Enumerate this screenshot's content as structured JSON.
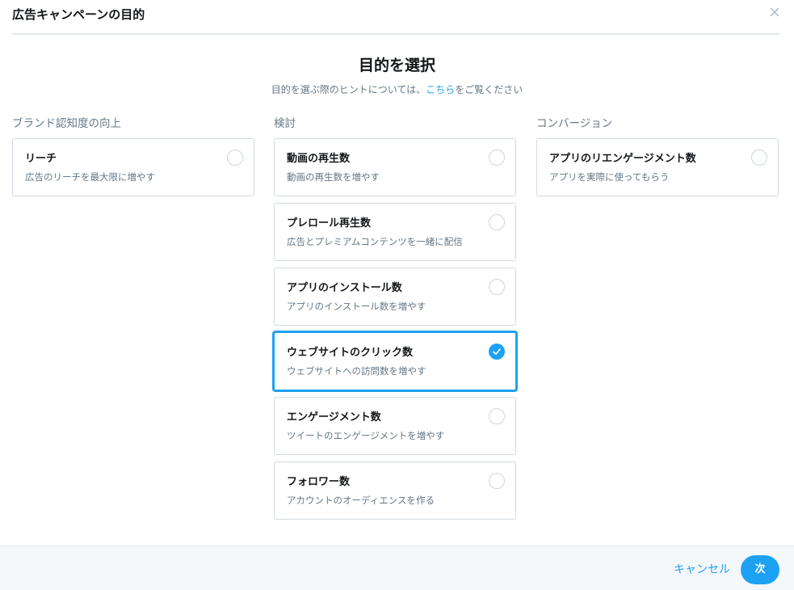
{
  "header": {
    "title": "広告キャンペーンの目的"
  },
  "main": {
    "title": "目的を選択",
    "subtitle_prefix": "目的を選ぶ際のヒントについては、",
    "subtitle_link": "こちら",
    "subtitle_suffix": "をご覧ください"
  },
  "columns": [
    {
      "heading": "ブランド認知度の向上",
      "options": [
        {
          "title": "リーチ",
          "desc": "広告のリーチを最大限に増やす",
          "selected": false
        }
      ]
    },
    {
      "heading": "検討",
      "options": [
        {
          "title": "動画の再生数",
          "desc": "動画の再生数を増やす",
          "selected": false
        },
        {
          "title": "プレロール再生数",
          "desc": "広告とプレミアムコンテンツを一緒に配信",
          "selected": false
        },
        {
          "title": "アプリのインストール数",
          "desc": "アプリのインストール数を増やす",
          "selected": false
        },
        {
          "title": "ウェブサイトのクリック数",
          "desc": "ウェブサイトへの訪問数を増やす",
          "selected": true
        },
        {
          "title": "エンゲージメント数",
          "desc": "ツイートのエンゲージメントを増やす",
          "selected": false
        },
        {
          "title": "フォロワー数",
          "desc": "アカウントのオーディエンスを作る",
          "selected": false
        }
      ]
    },
    {
      "heading": "コンバージョン",
      "options": [
        {
          "title": "アプリのリエンゲージメント数",
          "desc": "アプリを実際に使ってもらう",
          "selected": false
        }
      ]
    }
  ],
  "footer": {
    "cancel_label": "キャンセル",
    "next_label": "次"
  },
  "icons": {
    "close": "close-icon",
    "check": "checkmark-icon"
  },
  "colors": {
    "accent": "#1da1f2",
    "text": "#14171a",
    "muted": "#657786",
    "border": "#d3dbe1",
    "footer_bg": "#f5f8fa"
  }
}
